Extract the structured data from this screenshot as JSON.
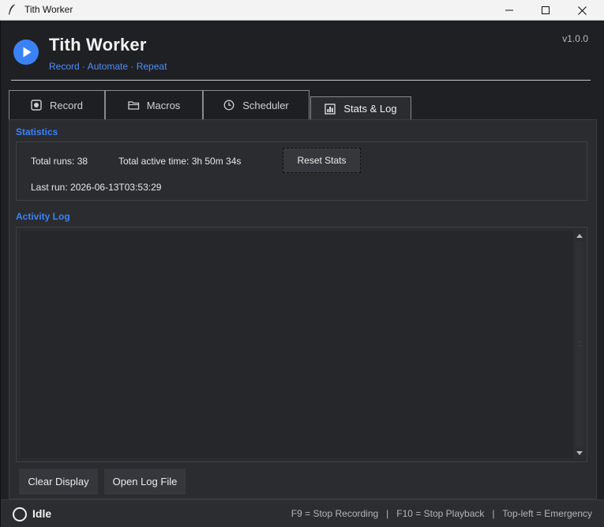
{
  "window": {
    "title": "Tith Worker",
    "controls": {
      "minimize": "minimize-icon",
      "maximize": "maximize-icon",
      "close": "close-icon"
    }
  },
  "header": {
    "app_name": "Tith Worker",
    "tagline": "Record · Automate · Repeat",
    "version": "v1.0.0",
    "logo_icon": "play-icon",
    "accent_color": "#3b82f6"
  },
  "tabs": [
    {
      "label": "Record",
      "icon": "record-icon",
      "active": false
    },
    {
      "label": "Macros",
      "icon": "folder-icon",
      "active": false
    },
    {
      "label": "Scheduler",
      "icon": "clock-icon",
      "active": false
    },
    {
      "label": "Stats & Log",
      "icon": "bar-chart-icon",
      "active": true
    }
  ],
  "statistics": {
    "title": "Statistics",
    "total_runs": "Total runs: 38",
    "total_active_time": "Total active time: 3h 50m 34s",
    "last_run": "Last run: 2026-06-13T03:53:29",
    "reset_label": "Reset Stats"
  },
  "activity_log": {
    "title": "Activity Log",
    "content": "",
    "clear_label": "Clear Display",
    "open_label": "Open Log File"
  },
  "status_bar": {
    "status": "Idle",
    "status_icon": "idle-circle-icon",
    "hotkeys": "F9 = Stop Recording   |   F10 = Stop Playback   |   Top-left = Emergency"
  }
}
